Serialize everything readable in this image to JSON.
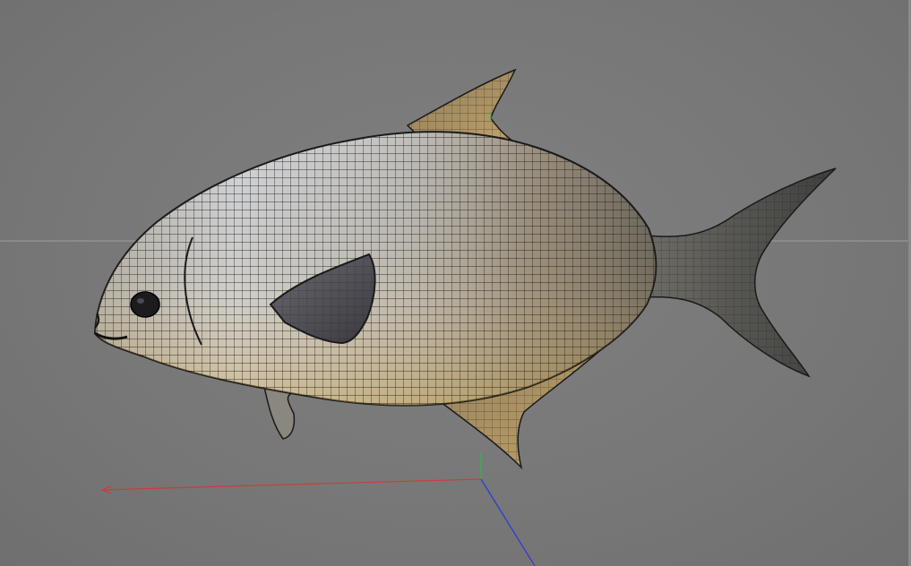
{
  "viewport": {
    "background_color": "#7a7a7a",
    "horizon_line_color": "#a8a8a8",
    "model": "fish-wireframe-mesh",
    "mesh_line_color": "#1a1a1a",
    "axes": {
      "x_color": "#d03a3a",
      "y_color": "#2fb84a",
      "z_color": "#2a3ad8"
    }
  }
}
